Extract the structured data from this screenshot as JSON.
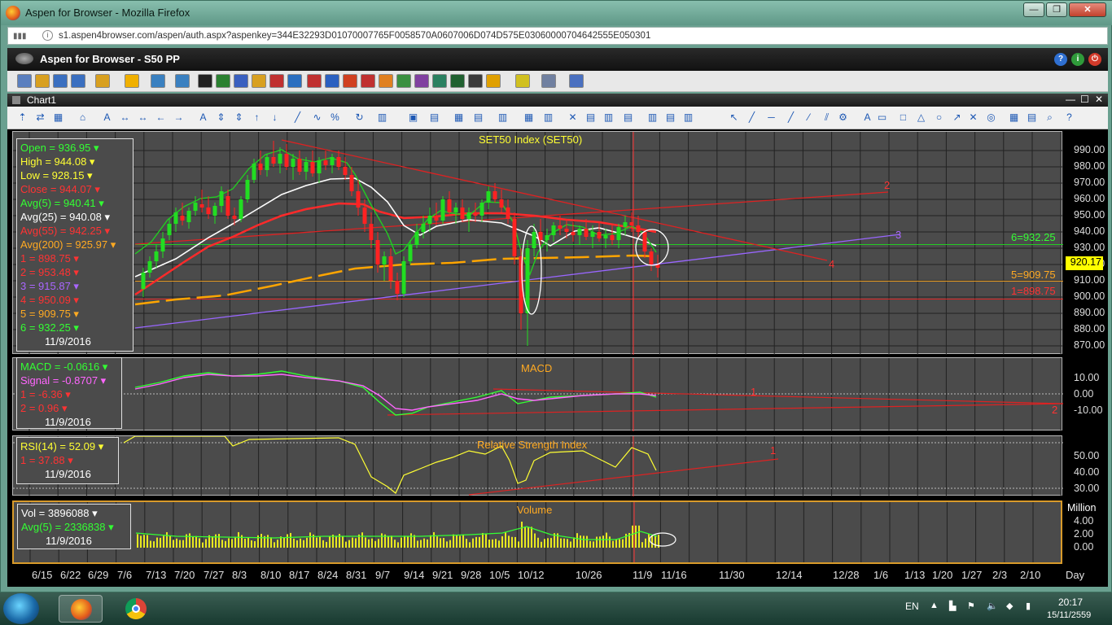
{
  "window": {
    "title": "Aspen for Browser - Mozilla Firefox",
    "url": "s1.aspen4browser.com/aspen/auth.aspx?aspenkey=344E32293D01070007765F0058570A0607006D074D575E03060000704642555E050301"
  },
  "app": {
    "title": "Aspen for Browser  -  S50 PP"
  },
  "chart_window": {
    "title": "Chart1"
  },
  "price_panel": {
    "title": "SET50 Index (SET50)",
    "legend": [
      {
        "text": "Open = 936.95",
        "color": "#33ff33"
      },
      {
        "text": "High = 944.08",
        "color": "#ffff33"
      },
      {
        "text": "Low = 928.15",
        "color": "#ffff33"
      },
      {
        "text": "Close = 944.07",
        "color": "#ff3333"
      },
      {
        "text": "Avg(5) = 940.41",
        "color": "#33ff33"
      },
      {
        "text": "Avg(25) = 940.08",
        "color": "#ffffff"
      },
      {
        "text": "Avg(55) = 942.25",
        "color": "#ff3333"
      },
      {
        "text": "Avg(200) = 925.97",
        "color": "#ffaa22"
      },
      {
        "text": "1 = 898.75",
        "color": "#ff3333"
      },
      {
        "text": "2 = 953.48",
        "color": "#ff3333"
      },
      {
        "text": "3 = 915.87",
        "color": "#aa66ff"
      },
      {
        "text": "4 = 950.09",
        "color": "#ff3333"
      },
      {
        "text": "5 = 909.75",
        "color": "#ffaa22"
      },
      {
        "text": "6 = 932.25",
        "color": "#33ff33"
      }
    ],
    "date": "11/9/2016",
    "yticks": [
      "990.00",
      "980.00",
      "970.00",
      "960.00",
      "950.00",
      "940.00",
      "930.00",
      "920.00",
      "910.00",
      "900.00",
      "890.00",
      "880.00",
      "870.00"
    ],
    "current_price": "920.17",
    "line_labels": [
      {
        "text": "6=932.25",
        "color": "#33ff33"
      },
      {
        "text": "5=909.75",
        "color": "#ffaa22"
      },
      {
        "text": "1=898.75",
        "color": "#ff3333"
      },
      {
        "text": "2",
        "color": "#ff3333"
      },
      {
        "text": "3",
        "color": "#aa66ff"
      },
      {
        "text": "4",
        "color": "#ff3333"
      }
    ]
  },
  "macd_panel": {
    "title": "MACD",
    "legend": [
      {
        "text": "MACD = -0.0616",
        "color": "#33ff33"
      },
      {
        "text": "Signal = -0.8707",
        "color": "#ff66ff"
      },
      {
        "text": "1 = -6.36",
        "color": "#ff3333"
      },
      {
        "text": "2 = 0.96",
        "color": "#ff3333"
      }
    ],
    "date": "11/9/2016",
    "yticks": [
      "10.00",
      "0.00",
      "-10.00"
    ],
    "line_labels": [
      "1",
      "2"
    ]
  },
  "rsi_panel": {
    "title": "Relative Strength Index",
    "legend": [
      {
        "text": "RSI(14) = 52.09",
        "color": "#ffff33"
      },
      {
        "text": "1 = 37.88",
        "color": "#ff3333"
      }
    ],
    "date": "11/9/2016",
    "yticks": [
      "50.00",
      "40.00",
      "30.00"
    ],
    "line_labels": [
      "1"
    ]
  },
  "volume_panel": {
    "title": "Volume",
    "legend": [
      {
        "text": "Vol = 3896088",
        "color": "#ffffff"
      },
      {
        "text": "Avg(5) = 2336838",
        "color": "#33ff33"
      }
    ],
    "date": "11/9/2016",
    "unit": "Million",
    "yticks": [
      "4.00",
      "2.00",
      "0.00"
    ]
  },
  "xaxis": {
    "labels": [
      "6/15",
      "6/22",
      "6/29",
      "7/6",
      "7/13",
      "7/20",
      "7/27",
      "8/3",
      "8/10",
      "8/17",
      "8/24",
      "8/31",
      "9/7",
      "9/14",
      "9/21",
      "9/28",
      "10/5",
      "10/12",
      "10/26",
      "11/9",
      "11/16",
      "11/30",
      "12/14",
      "12/28",
      "1/6",
      "1/13",
      "1/20",
      "1/27",
      "2/3",
      "2/10"
    ],
    "period": "Day"
  },
  "colors": {
    "panel_bg": "#4b4b4b",
    "grid": "#222222",
    "accent_volume_border": "#d89a2a"
  },
  "taskbar": {
    "lang": "EN",
    "time": "20:17",
    "date": "15/11/2559"
  }
}
